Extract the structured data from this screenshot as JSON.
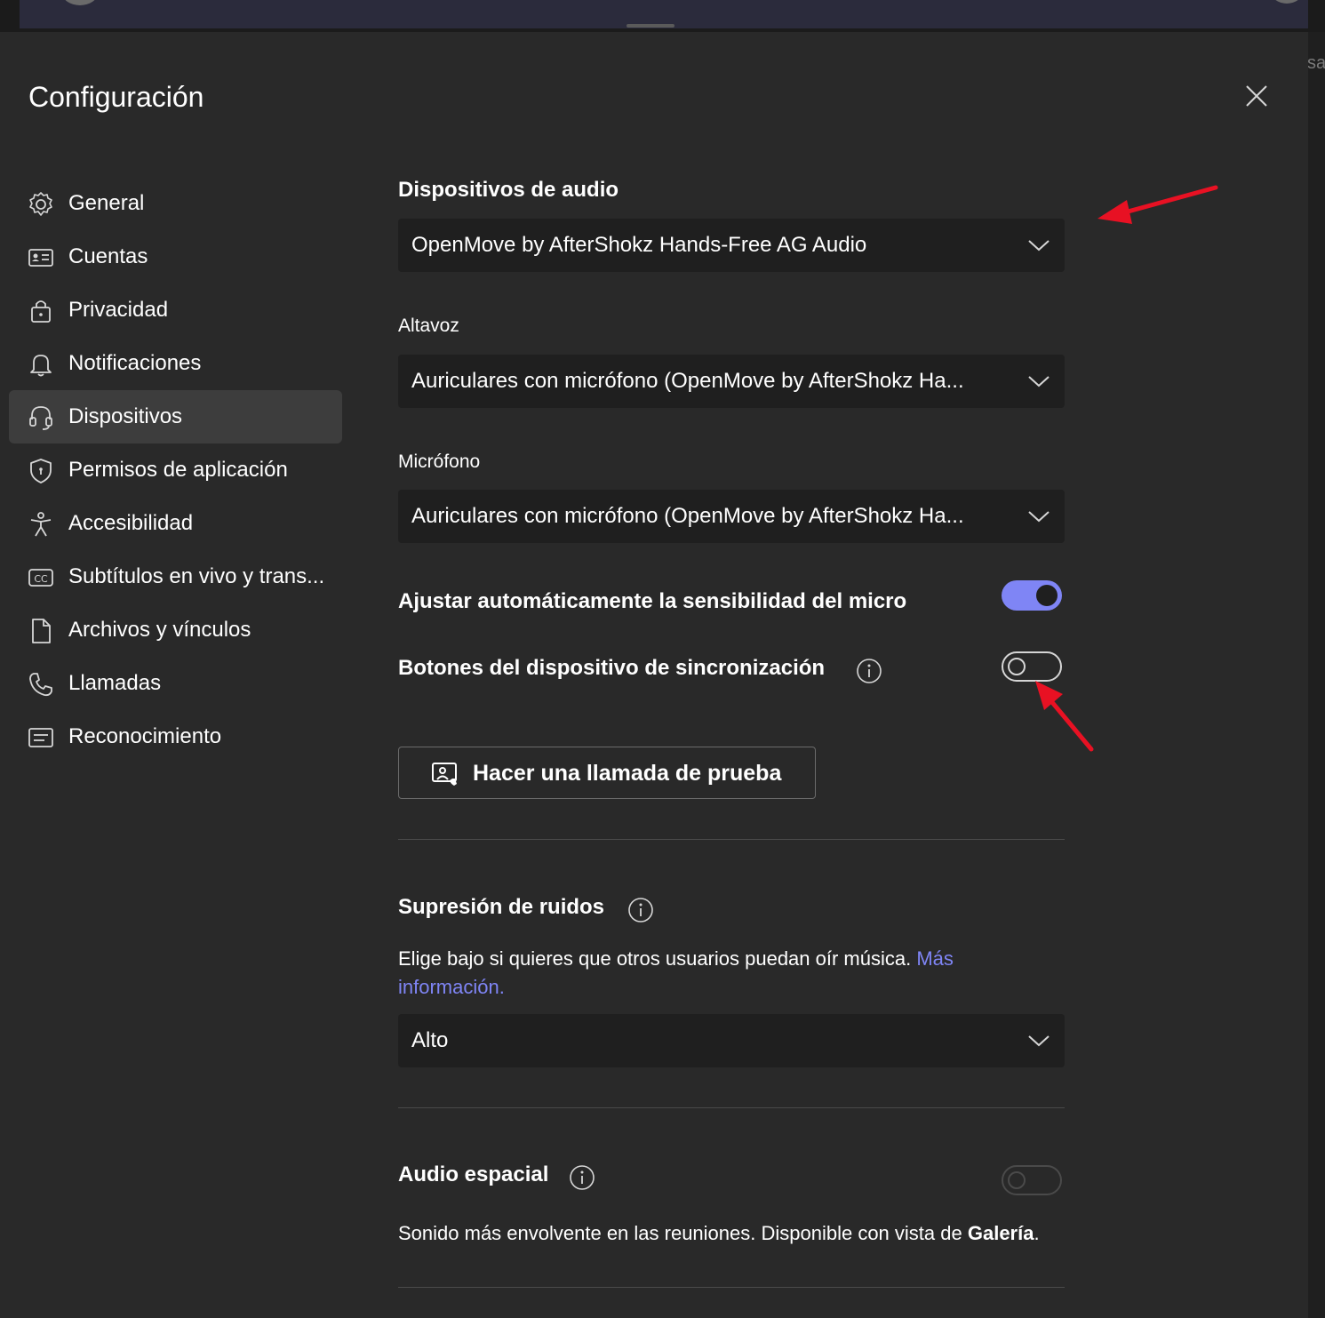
{
  "background_strip": {
    "partial_text": "sa"
  },
  "dialog": {
    "title": "Configuración",
    "close_icon": "close-icon"
  },
  "sidebar": {
    "items": [
      {
        "label": "General",
        "icon": "gear-icon",
        "active": false
      },
      {
        "label": "Cuentas",
        "icon": "id-card-icon",
        "active": false
      },
      {
        "label": "Privacidad",
        "icon": "lock-icon",
        "active": false
      },
      {
        "label": "Notificaciones",
        "icon": "bell-icon",
        "active": false
      },
      {
        "label": "Dispositivos",
        "icon": "headset-icon",
        "active": true
      },
      {
        "label": "Permisos de aplicación",
        "icon": "shield-icon",
        "active": false
      },
      {
        "label": "Accesibilidad",
        "icon": "accessibility-icon",
        "active": false
      },
      {
        "label": "Subtítulos en vivo y trans...",
        "icon": "cc-icon",
        "active": false
      },
      {
        "label": "Archivos y vínculos",
        "icon": "file-icon",
        "active": false
      },
      {
        "label": "Llamadas",
        "icon": "phone-icon",
        "active": false
      },
      {
        "label": "Reconocimiento",
        "icon": "card-icon",
        "active": false
      }
    ]
  },
  "devices": {
    "audio_devices_heading": "Dispositivos de audio",
    "audio_device_value": "OpenMove by AfterShokz Hands-Free AG Audio",
    "speaker_label": "Altavoz",
    "speaker_value": "Auriculares con micrófono (OpenMove by AfterShokz Ha...",
    "mic_label": "Micrófono",
    "mic_value": "Auriculares con micrófono (OpenMove by AfterShokz Ha...",
    "auto_sensitivity_label": "Ajustar automáticamente la sensibilidad del micro",
    "auto_sensitivity_on": true,
    "sync_buttons_label": "Botones del dispositivo de sincronización",
    "sync_buttons_on": false,
    "test_call_label": "Hacer una llamada de prueba",
    "noise_heading": "Supresión de ruidos",
    "noise_desc": "Elige bajo si quieres que otros usuarios puedan oír música.",
    "noise_link_1": "Más",
    "noise_link_2": "información.",
    "noise_value": "Alto",
    "spatial_heading": "Audio espacial",
    "spatial_on": false,
    "spatial_desc_prefix": "Sonido más envolvente en las reuniones. Disponible con vista de",
    "spatial_desc_bold": "Galería",
    "spatial_desc_suffix": "."
  },
  "colors": {
    "accent": "#7f85f5",
    "annotation_arrow": "#e81123",
    "dialog_bg": "#292929",
    "input_bg": "#1f1f1f"
  }
}
